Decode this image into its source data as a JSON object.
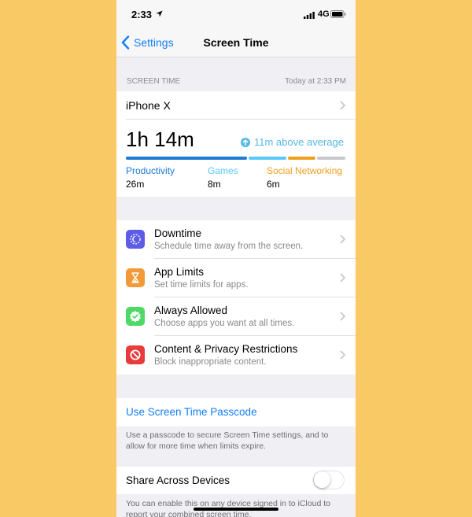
{
  "status": {
    "time": "2:33",
    "network": "4G"
  },
  "nav": {
    "back_label": "Settings",
    "title": "Screen Time"
  },
  "section": {
    "header": "SCREEN TIME",
    "timestamp": "Today at 2:33 PM"
  },
  "device": {
    "name": "iPhone X"
  },
  "usage": {
    "total": "1h 14m",
    "average_note": "11m above average",
    "categories": [
      {
        "name": "Productivity",
        "value": "26m",
        "minutes": 26,
        "color": "#1b7bd3"
      },
      {
        "name": "Games",
        "value": "8m",
        "minutes": 8,
        "color": "#5ac8fa"
      },
      {
        "name": "Social Networking",
        "value": "6m",
        "minutes": 6,
        "color": "#f0a020"
      }
    ],
    "other_minutes": 6,
    "other_color": "#c7c7cc"
  },
  "menu": [
    {
      "title": "Downtime",
      "subtitle": "Schedule time away from the screen.",
      "icon": "downtime-icon",
      "color": "#5d5ce6"
    },
    {
      "title": "App Limits",
      "subtitle": "Set time limits for apps.",
      "icon": "hourglass-icon",
      "color": "#f19a37"
    },
    {
      "title": "Always Allowed",
      "subtitle": "Choose apps you want at all times.",
      "icon": "checkmark-seal-icon",
      "color": "#4cd964"
    },
    {
      "title": "Content & Privacy Restrictions",
      "subtitle": "Block inappropriate content.",
      "icon": "no-entry-icon",
      "color": "#e83c3c"
    }
  ],
  "passcode": {
    "label": "Use Screen Time Passcode",
    "footnote": "Use a passcode to secure Screen Time settings, and to allow for more time when limits expire."
  },
  "share": {
    "label": "Share Across Devices",
    "enabled": false,
    "footnote": "You can enable this on any device signed in to iCloud to report your combined screen time."
  }
}
